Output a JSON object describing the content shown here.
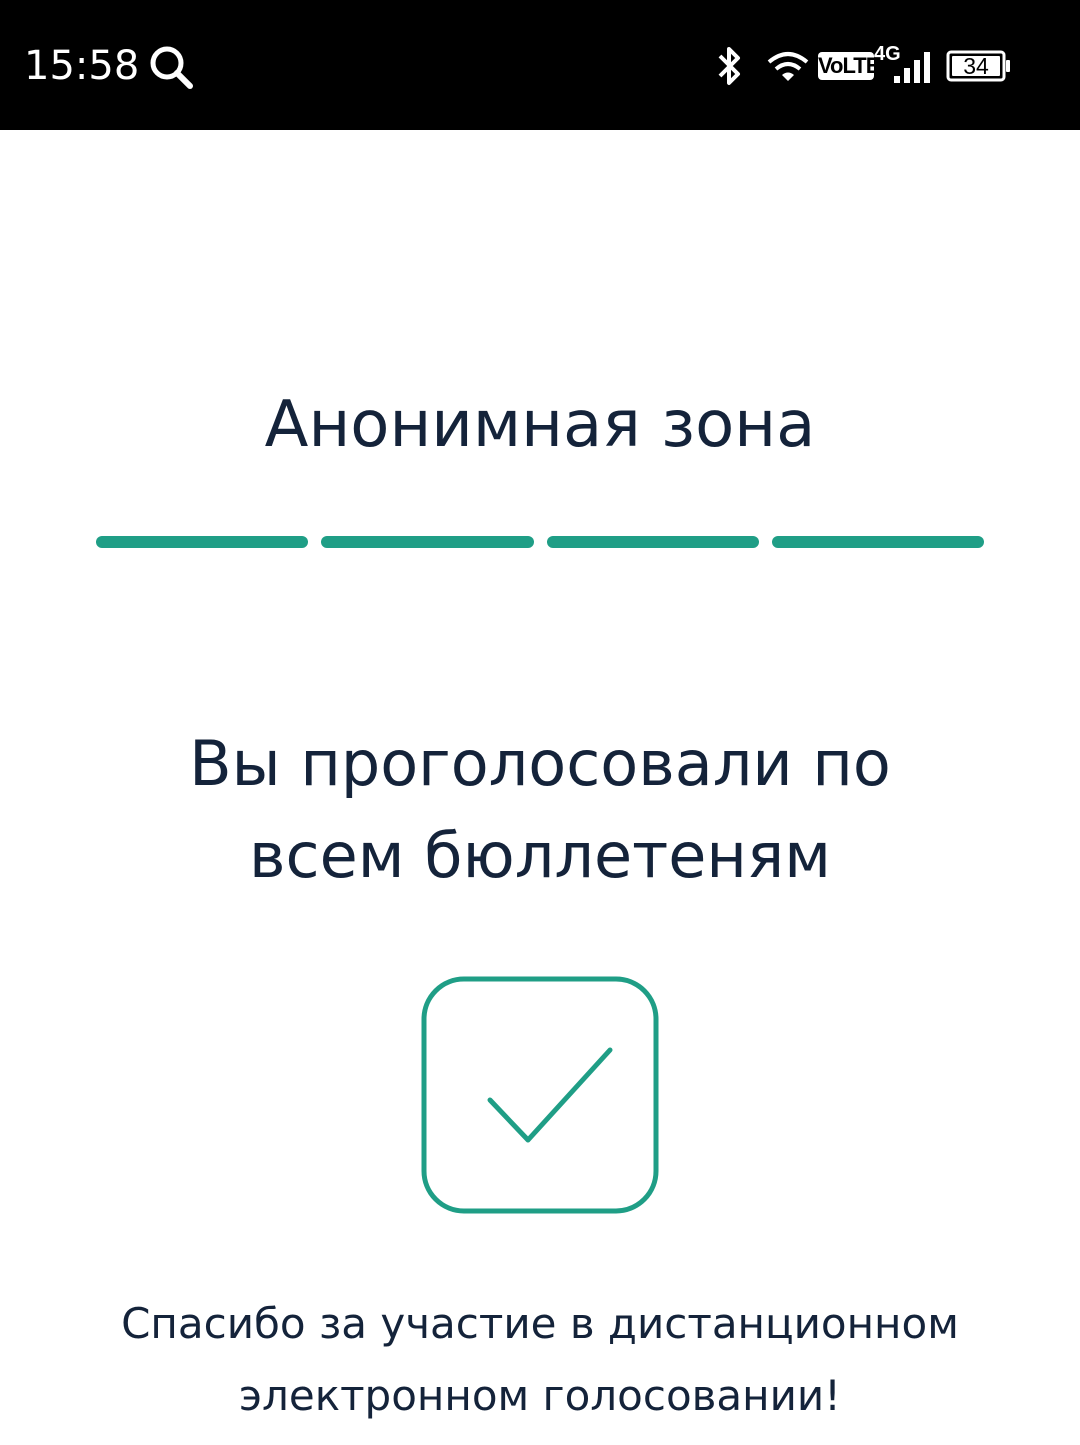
{
  "status_bar": {
    "time": "15:58",
    "network_label": "VoLTE",
    "network_type": "4G",
    "battery_level": "34",
    "icons": [
      "search-icon",
      "bluetooth-icon",
      "wifi-icon",
      "signal-icon",
      "battery-icon"
    ]
  },
  "main": {
    "zone_title": "Анонимная зона",
    "progress": {
      "total_steps": 4,
      "completed_steps": 4
    },
    "result_line1": "Вы проголосовали по",
    "result_line2": "всем бюллетеням",
    "status_icon": "checkbox-checked-icon",
    "thanks_line1": "Спасибо за участие в дистанционном",
    "thanks_line2": "электронном голосовании!"
  },
  "colors": {
    "accent": "#1f9e86",
    "text": "#14233a",
    "status_bar": "#000000",
    "background": "#ffffff"
  }
}
